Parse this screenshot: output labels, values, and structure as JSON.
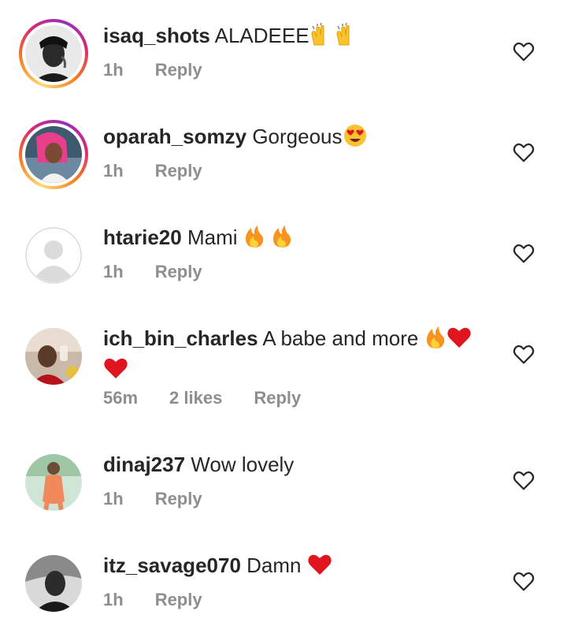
{
  "comments": [
    {
      "username": "isaq_shots",
      "text": "ALADEEE",
      "emoji": [
        "raised-hands-emoji",
        "raised-hands-emoji"
      ],
      "time": "1h",
      "likes": "",
      "reply": "Reply"
    },
    {
      "username": "oparah_somzy",
      "text": "Gorgeous",
      "emoji": [
        "heart-eyes-emoji"
      ],
      "time": "1h",
      "likes": "",
      "reply": "Reply"
    },
    {
      "username": "htarie20",
      "text": "Mami",
      "emoji": [
        "fire-emoji",
        "fire-emoji"
      ],
      "time": "1h",
      "likes": "",
      "reply": "Reply"
    },
    {
      "username": "ich_bin_charles",
      "text": "A babe and more",
      "emoji": [
        "fire-emoji",
        "red-heart-emoji",
        "red-heart-emoji"
      ],
      "time": "56m",
      "likes": "2 likes",
      "reply": "Reply"
    },
    {
      "username": "dinaj237",
      "text": "Wow lovely",
      "emoji": [],
      "time": "1h",
      "likes": "",
      "reply": "Reply"
    },
    {
      "username": "itz_savage070",
      "text": "Damn",
      "emoji": [
        "red-heart-emoji"
      ],
      "time": "1h",
      "likes": "",
      "reply": "Reply"
    }
  ],
  "colors": {
    "text": "#262626",
    "meta": "#8e8e8e",
    "heart-red": "#e0151f",
    "fire": "#f7931e"
  }
}
